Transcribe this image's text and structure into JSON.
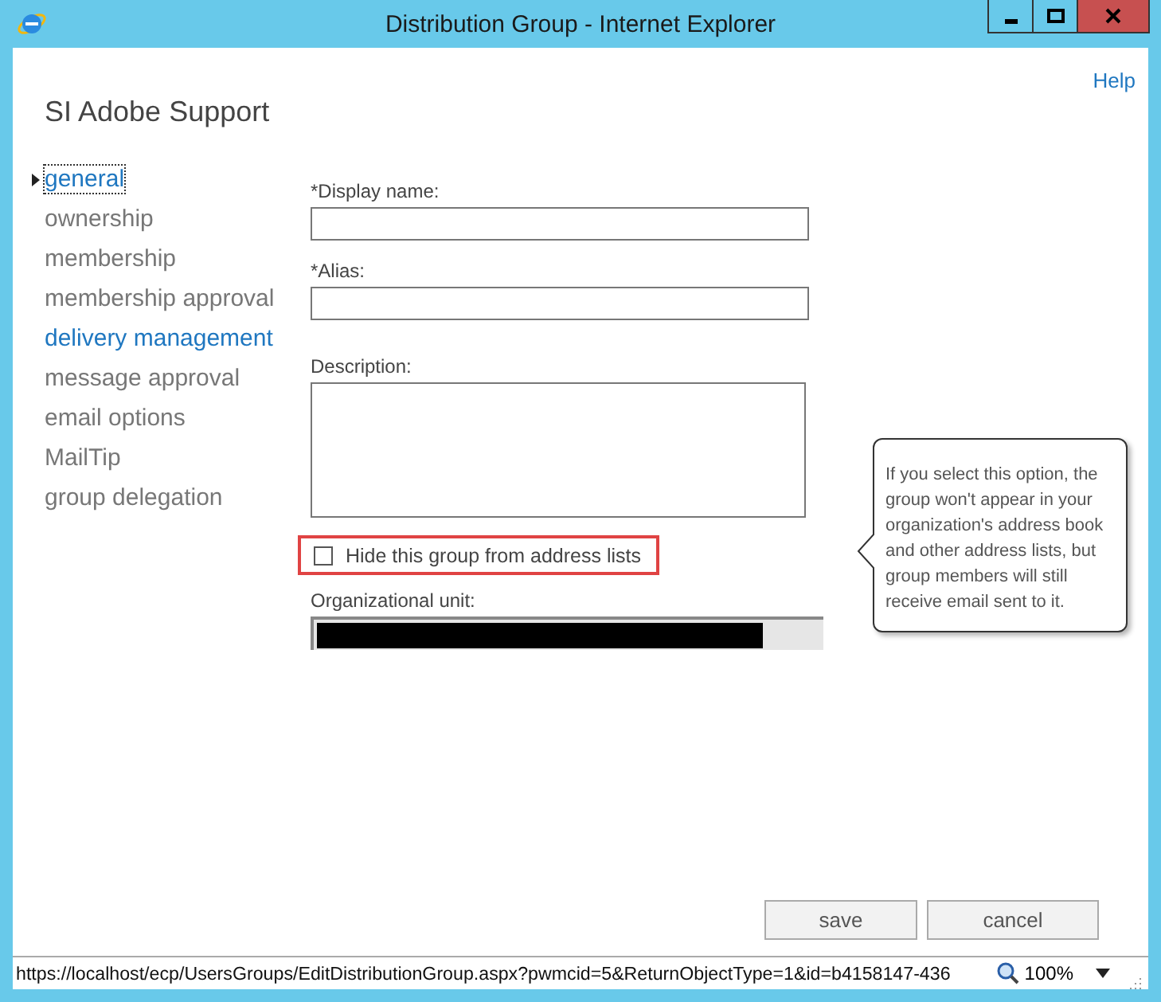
{
  "window": {
    "title": "Distribution Group - Internet Explorer"
  },
  "help": "Help",
  "heading": "SI Adobe Support",
  "nav": [
    {
      "label": "general",
      "selected": true,
      "highlighted": false
    },
    {
      "label": "ownership",
      "selected": false,
      "highlighted": false
    },
    {
      "label": "membership",
      "selected": false,
      "highlighted": false
    },
    {
      "label": "membership approval",
      "selected": false,
      "highlighted": false
    },
    {
      "label": "delivery management",
      "selected": false,
      "highlighted": true
    },
    {
      "label": "message approval",
      "selected": false,
      "highlighted": false
    },
    {
      "label": "email options",
      "selected": false,
      "highlighted": false
    },
    {
      "label": "MailTip",
      "selected": false,
      "highlighted": false
    },
    {
      "label": "group delegation",
      "selected": false,
      "highlighted": false
    }
  ],
  "fields": [
    {
      "label": "*Display name:",
      "kind": "text"
    },
    {
      "label": "*Alias:",
      "kind": "text"
    },
    {
      "label": "Description:",
      "kind": "textarea"
    }
  ],
  "hide_checkbox": {
    "label": "Hide this group from address lists",
    "checked": false
  },
  "org_unit": {
    "label": "Organizational unit:"
  },
  "tooltip": "If you select this option, the group won't appear in your organization's address book and other address lists, but group members will still receive email sent to it.",
  "buttons": [
    "save",
    "cancel"
  ],
  "status_bar": {
    "url": "https://localhost/ecp/UsersGroups/EditDistributionGroup.aspx?pwmcid=5&ReturnObjectType=1&id=b4158147-436",
    "zoom": "100%"
  }
}
